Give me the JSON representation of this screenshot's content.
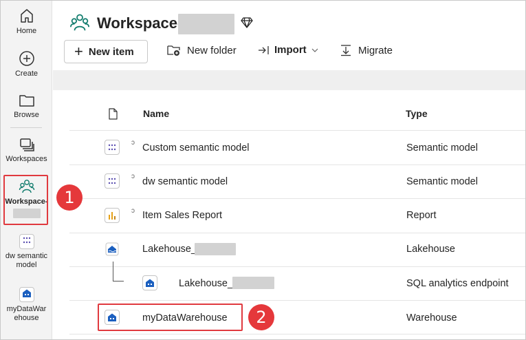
{
  "rail": {
    "home": "Home",
    "create": "Create",
    "browse": "Browse",
    "workspaces": "Workspaces",
    "workspace": "Workspace-",
    "dw_semantic_model_line1": "dw semantic",
    "dw_semantic_model_line2": "model",
    "mydatawarehouse_line1": "myDataWar",
    "mydatawarehouse_line2": "ehouse"
  },
  "header": {
    "title": "Workspace-"
  },
  "toolbar": {
    "new_item": "New item",
    "new_folder": "New folder",
    "import": "Import",
    "migrate": "Migrate"
  },
  "table": {
    "col_name": "Name",
    "col_type": "Type",
    "rows": [
      {
        "name": "Custom semantic model",
        "type": "Semantic model"
      },
      {
        "name": "dw semantic model",
        "type": "Semantic model"
      },
      {
        "name": "Item Sales Report",
        "type": "Report"
      },
      {
        "name": "Lakehouse_",
        "type": "Lakehouse"
      },
      {
        "name": "Lakehouse_",
        "type": "SQL analytics endpoint"
      },
      {
        "name": "myDataWarehouse",
        "type": "Warehouse"
      }
    ]
  },
  "callouts": {
    "one": "1",
    "two": "2"
  },
  "colors": {
    "accent_red": "#e0393e",
    "workspace_green": "#0f7b6c",
    "warehouse_blue": "#1b5fbf"
  }
}
